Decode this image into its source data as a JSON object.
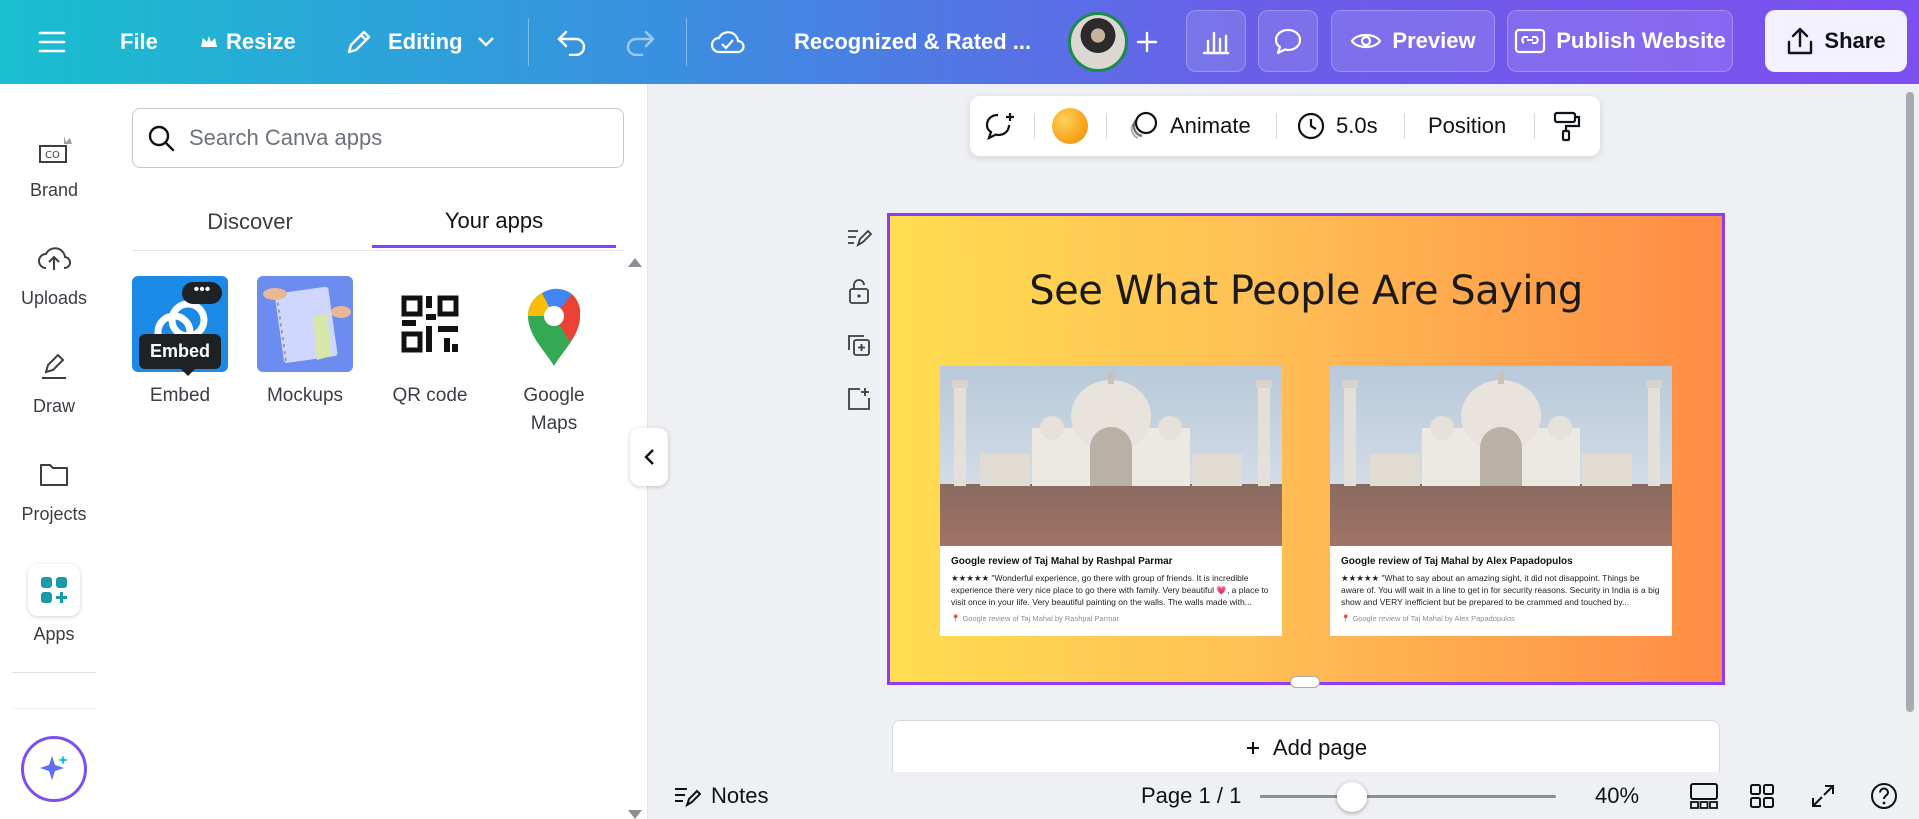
{
  "topbar": {
    "file_label": "File",
    "resize_label": "Resize",
    "mode_label": "Editing",
    "doc_title": "Recognized & Rated ...",
    "preview_label": "Preview",
    "publish_label": "Publish Website",
    "share_label": "Share"
  },
  "rail": {
    "items": [
      {
        "label": "Brand",
        "icon": "brand-icon"
      },
      {
        "label": "Uploads",
        "icon": "upload-cloud-icon"
      },
      {
        "label": "Draw",
        "icon": "pen-icon"
      },
      {
        "label": "Projects",
        "icon": "folder-icon"
      },
      {
        "label": "Apps",
        "icon": "apps-grid-icon"
      }
    ]
  },
  "panel": {
    "search_placeholder": "Search Canva apps",
    "tabs": [
      "Discover",
      "Your apps"
    ],
    "active_tab": "Your apps",
    "apps": [
      {
        "label": "Embed"
      },
      {
        "label": "Mockups"
      },
      {
        "label": "QR code"
      },
      {
        "label": "Google Maps"
      }
    ],
    "tooltip": "Embed"
  },
  "context_toolbar": {
    "color": "#f7a51c",
    "animate_label": "Animate",
    "duration_label": "5.0s",
    "position_label": "Position"
  },
  "slide": {
    "title": "See What People Are Saying",
    "cards": [
      {
        "title": "Google review of Taj Mahal by Rashpal Parmar",
        "text": "★★★★★ \"Wonderful experience, go there with group of friends. It is incredible experience there very nice place to go there with family. Very beautiful 💗, a place to visit once in your life. Very beautiful painting on the walls. The walls made with...",
        "source": "Google review of Taj Mahal by Rashpal Parmar"
      },
      {
        "title": "Google review of Taj Mahal by Alex Papadopulos",
        "text": "★★★★★ \"What to say about an amazing sight, it did not disappoint. Things be aware of. You will wait in a line to get in for security reasons. Security in India is a big show and VERY inefficient but be prepared to be crammed and touched by...",
        "source": "Google review of Taj Mahal by Alex Papadopulos"
      }
    ]
  },
  "add_page_label": "Add page",
  "footer": {
    "notes_label": "Notes",
    "page_label": "Page 1 / 1",
    "zoom_label": "40%",
    "zoom_fraction": 0.31
  },
  "colors": {
    "accent": "#8b3dff",
    "topbar_start": "#19bfcf",
    "topbar_end": "#7d4ff0"
  }
}
